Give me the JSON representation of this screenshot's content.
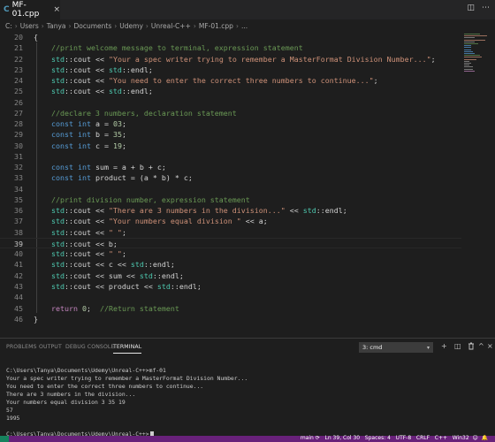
{
  "tab": {
    "icon": "C",
    "label": "MF-01.cpp",
    "close": "×"
  },
  "breadcrumb": [
    "C:",
    "Users",
    "Tanya",
    "Documents",
    "Udemy",
    "Unreal-C++",
    "MF-01.cpp",
    "..."
  ],
  "editor": {
    "current_line": 39,
    "lines": [
      {
        "n": 20,
        "tokens": [
          [
            "p",
            "{"
          ]
        ]
      },
      {
        "n": 21,
        "tokens": [
          [
            "p",
            "    "
          ],
          [
            "cmt",
            "//print welcome message to terminal, expression statement"
          ]
        ]
      },
      {
        "n": 22,
        "tokens": [
          [
            "p",
            "    "
          ],
          [
            "ns",
            "std"
          ],
          [
            "p",
            "::"
          ],
          [
            "p",
            "cout << "
          ],
          [
            "str",
            "\"Your a spec writer trying to remember a MasterFormat Division Number...\""
          ],
          [
            "p",
            ";"
          ]
        ]
      },
      {
        "n": 23,
        "tokens": [
          [
            "p",
            "    "
          ],
          [
            "ns",
            "std"
          ],
          [
            "p",
            "::cout << "
          ],
          [
            "ns",
            "std"
          ],
          [
            "p",
            "::endl;"
          ]
        ]
      },
      {
        "n": 24,
        "tokens": [
          [
            "p",
            "    "
          ],
          [
            "ns",
            "std"
          ],
          [
            "p",
            "::cout << "
          ],
          [
            "str",
            "\"You need to enter the correct three numbers to continue...\""
          ],
          [
            "p",
            ";"
          ]
        ]
      },
      {
        "n": 25,
        "tokens": [
          [
            "p",
            "    "
          ],
          [
            "ns",
            "std"
          ],
          [
            "p",
            "::cout << "
          ],
          [
            "ns",
            "std"
          ],
          [
            "p",
            "::endl;"
          ]
        ]
      },
      {
        "n": 26,
        "tokens": []
      },
      {
        "n": 27,
        "tokens": [
          [
            "p",
            "    "
          ],
          [
            "cmt",
            "//declare 3 numbers, declaration statement"
          ]
        ]
      },
      {
        "n": 28,
        "tokens": [
          [
            "p",
            "    "
          ],
          [
            "kw",
            "const"
          ],
          [
            "p",
            " "
          ],
          [
            "kw",
            "int"
          ],
          [
            "p",
            " a = "
          ],
          [
            "num",
            "03"
          ],
          [
            "p",
            ";"
          ]
        ]
      },
      {
        "n": 29,
        "tokens": [
          [
            "p",
            "    "
          ],
          [
            "kw",
            "const"
          ],
          [
            "p",
            " "
          ],
          [
            "kw",
            "int"
          ],
          [
            "p",
            " b = "
          ],
          [
            "num",
            "35"
          ],
          [
            "p",
            ";"
          ]
        ]
      },
      {
        "n": 30,
        "tokens": [
          [
            "p",
            "    "
          ],
          [
            "kw",
            "const"
          ],
          [
            "p",
            " "
          ],
          [
            "kw",
            "int"
          ],
          [
            "p",
            " c = "
          ],
          [
            "num",
            "19"
          ],
          [
            "p",
            ";"
          ]
        ]
      },
      {
        "n": 31,
        "tokens": []
      },
      {
        "n": 32,
        "tokens": [
          [
            "p",
            "    "
          ],
          [
            "kw",
            "const"
          ],
          [
            "p",
            " "
          ],
          [
            "kw",
            "int"
          ],
          [
            "p",
            " sum = a + b + c;"
          ]
        ]
      },
      {
        "n": 33,
        "tokens": [
          [
            "p",
            "    "
          ],
          [
            "kw",
            "const"
          ],
          [
            "p",
            " "
          ],
          [
            "kw",
            "int"
          ],
          [
            "p",
            " product = (a * b) * c;"
          ]
        ]
      },
      {
        "n": 34,
        "tokens": []
      },
      {
        "n": 35,
        "tokens": [
          [
            "p",
            "    "
          ],
          [
            "cmt",
            "//print division number, expression statement"
          ]
        ]
      },
      {
        "n": 36,
        "tokens": [
          [
            "p",
            "    "
          ],
          [
            "ns",
            "std"
          ],
          [
            "p",
            "::cout << "
          ],
          [
            "str",
            "\"There are 3 numbers in the division...\""
          ],
          [
            "p",
            " << "
          ],
          [
            "ns",
            "std"
          ],
          [
            "p",
            "::endl;"
          ]
        ]
      },
      {
        "n": 37,
        "tokens": [
          [
            "p",
            "    "
          ],
          [
            "ns",
            "std"
          ],
          [
            "p",
            "::cout << "
          ],
          [
            "str",
            "\"Your numbers equal division \""
          ],
          [
            "p",
            " << a;"
          ]
        ]
      },
      {
        "n": 38,
        "tokens": [
          [
            "p",
            "    "
          ],
          [
            "ns",
            "std"
          ],
          [
            "p",
            "::cout << "
          ],
          [
            "str",
            "\" \""
          ],
          [
            "p",
            ";"
          ]
        ]
      },
      {
        "n": 39,
        "tokens": [
          [
            "p",
            "    "
          ],
          [
            "ns",
            "std"
          ],
          [
            "p",
            "::cout << b;"
          ]
        ]
      },
      {
        "n": 40,
        "tokens": [
          [
            "p",
            "    "
          ],
          [
            "ns",
            "std"
          ],
          [
            "p",
            "::cout << "
          ],
          [
            "str",
            "\" \""
          ],
          [
            "p",
            ";"
          ]
        ]
      },
      {
        "n": 41,
        "tokens": [
          [
            "p",
            "    "
          ],
          [
            "ns",
            "std"
          ],
          [
            "p",
            "::cout << c << "
          ],
          [
            "ns",
            "std"
          ],
          [
            "p",
            "::endl;"
          ]
        ]
      },
      {
        "n": 42,
        "tokens": [
          [
            "p",
            "    "
          ],
          [
            "ns",
            "std"
          ],
          [
            "p",
            "::cout << sum << "
          ],
          [
            "ns",
            "std"
          ],
          [
            "p",
            "::endl;"
          ]
        ]
      },
      {
        "n": 43,
        "tokens": [
          [
            "p",
            "    "
          ],
          [
            "ns",
            "std"
          ],
          [
            "p",
            "::cout << product << "
          ],
          [
            "ns",
            "std"
          ],
          [
            "p",
            "::endl;"
          ]
        ]
      },
      {
        "n": 44,
        "tokens": []
      },
      {
        "n": 45,
        "tokens": [
          [
            "p",
            "    "
          ],
          [
            "ret",
            "return"
          ],
          [
            "p",
            " "
          ],
          [
            "num",
            "0"
          ],
          [
            "p",
            ";  "
          ],
          [
            "cmt",
            "//Return statement"
          ]
        ]
      },
      {
        "n": 46,
        "tokens": [
          [
            "p",
            "}"
          ]
        ]
      }
    ]
  },
  "panel": {
    "tabs": [
      "PROBLEMS",
      "OUTPUT",
      "DEBUG CONSOLE",
      "TERMINAL"
    ],
    "active_tab": "TERMINAL",
    "terminal_select": "3: cmd",
    "actions": {
      "add": "+",
      "split": "◫",
      "kill": "🗑",
      "maximize": "^",
      "close": "×"
    }
  },
  "terminal": {
    "lines": [
      "C:\\Users\\Tanya\\Documents\\Udemy\\Unreal-C++>mf-01",
      "Your a spec writer trying to remember a MasterFormat Division Number...",
      "You need to enter the correct three numbers to continue...",
      "There are 3 numbers in the division...",
      "Your numbers equal division 3 35 19",
      "57",
      "1995",
      "",
      "C:\\Users\\Tanya\\Documents\\Udemy\\Unreal-C++>"
    ]
  },
  "status": {
    "text": "main ⟳   Ln 39, Col 30   Spaces: 4   UTF-8   CRLF   C++   Win32  ☺  🔔"
  },
  "colors": {
    "editor_bg": "#1e1e1e",
    "status_bar": "#68217a",
    "comment": "#6a9955",
    "string": "#ce9178",
    "keyword": "#569cd6",
    "namespace": "#4ec9b0",
    "number": "#b5cea8"
  }
}
